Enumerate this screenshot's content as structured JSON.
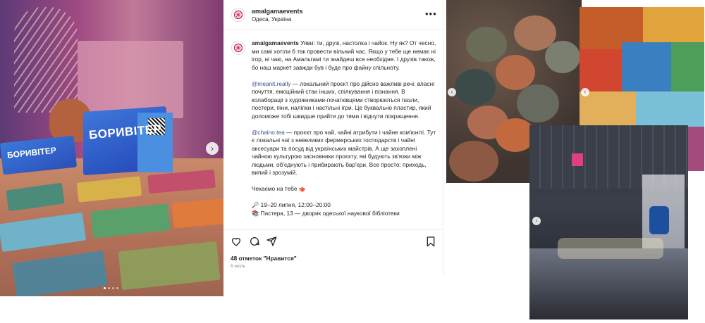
{
  "post": {
    "username": "amalgamaevents",
    "location": "Одеса, Україна",
    "more_label": "•••",
    "caption_author": "amalgamaevents",
    "caption_p1": " Уяви: ти, друзі, настолка і чайок. Ну як? От чесно, ми самі хотіли б так провести вільний час. Якщо у тебе ще немає ні ігор, ні чаю, на Амальгамі ти знайдеш все необхідне. І друзів також, бо наш маркет завжди був і буде про файну спільноту.",
    "mention1": "@meanit.really",
    "caption_p2": " — локальний проєкт про дійсно важливі речі: власні почуття, емоційний стан інших, спілкування і пізнання. В колабораціі з художниками-початківцями створюються пазли, постери, піни, наліпки і настільні ігри. Це буквально пластир, який допоможе тобі швидше прийти до тями і відчути покращення.",
    "mention2": "@chaino.tea",
    "caption_p3": " — проєкт про чай, чайні атрибути і чайне ком'юніті. Тут є локальні чаї з невеликих фермерських господарств і чайні аксесуари та посуд від українських майстрів. А ще захоплені чайною культурою засновники проєкту, які будують зв'язки між людьми, об'єднують і прибирають бар'єри. Все просто: приходь, випий і зрозумій.",
    "caption_p4": "Чекаємо на тебе 🫖",
    "event_time": "🔎 19–20 липня, 12:00–20:00",
    "event_place": "📚 Пастера, 13 — дворик одеської наукової бібліотеки",
    "likes": "48 отметок \"Нравится\"",
    "date": "6 июль"
  },
  "photo": {
    "box_title": "БОРИВІТЕР",
    "small_box_title": "БОРИВІТЕР",
    "next_arrow": "›",
    "slide_count": 4,
    "active_slide": 1
  },
  "gallery": {
    "prev_arrow": "‹"
  },
  "icons": [
    "heart-icon",
    "comment-icon",
    "share-icon",
    "bookmark-icon",
    "more-icon",
    "chevron-right-icon",
    "chevron-left-icon"
  ],
  "colors": {
    "mention": "#385185",
    "text": "#262626",
    "muted": "#8e8e8e"
  }
}
